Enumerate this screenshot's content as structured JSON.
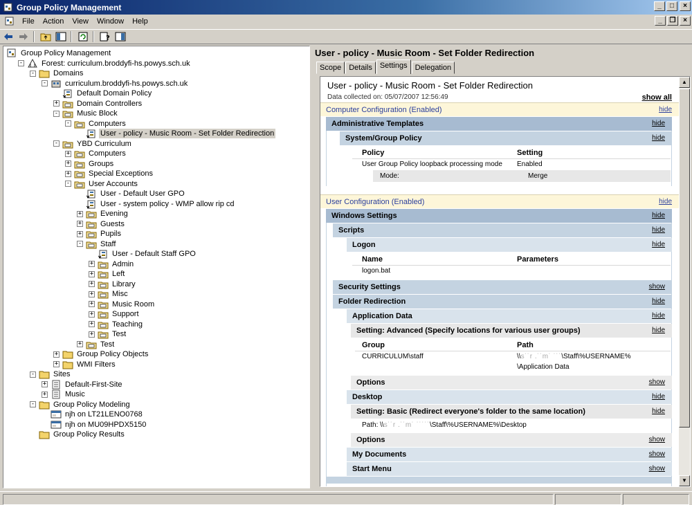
{
  "window": {
    "title": "Group Policy Management"
  },
  "menu": {
    "file": "File",
    "action": "Action",
    "view": "View",
    "window": "Window",
    "help": "Help"
  },
  "tree": [
    {
      "label": "Group Policy Management",
      "icon": "gpm-icon"
    },
    {
      "label": "Forest: curriculum.broddyfi-hs.powys.sch.uk",
      "icon": "forest-icon"
    },
    {
      "label": "Domains",
      "icon": "folder-icon"
    },
    {
      "label": "curriculum.broddyfi-hs.powys.sch.uk",
      "icon": "domain-icon"
    },
    {
      "label": "Default Domain Policy",
      "icon": "gpo-link-icon"
    },
    {
      "label": "Domain Controllers",
      "icon": "ou-icon"
    },
    {
      "label": "Music Block",
      "icon": "ou-icon"
    },
    {
      "label": "Computers",
      "icon": "ou-icon"
    },
    {
      "label": "User - policy - Music Room - Set Folder Redirection",
      "icon": "gpo-link-icon"
    },
    {
      "label": "YBD Curriculum",
      "icon": "ou-icon"
    },
    {
      "label": "Computers",
      "icon": "ou-icon"
    },
    {
      "label": "Groups",
      "icon": "ou-icon"
    },
    {
      "label": "Special Exceptions",
      "icon": "ou-icon"
    },
    {
      "label": "User Accounts",
      "icon": "ou-icon"
    },
    {
      "label": "User - Default User GPO",
      "icon": "gpo-link-icon"
    },
    {
      "label": "User - system policy - WMP allow rip cd",
      "icon": "gpo-link-icon"
    },
    {
      "label": "Evening",
      "icon": "ou-icon"
    },
    {
      "label": "Guests",
      "icon": "ou-icon"
    },
    {
      "label": "Pupils",
      "icon": "ou-icon"
    },
    {
      "label": "Staff",
      "icon": "ou-icon"
    },
    {
      "label": "User - Default Staff GPO",
      "icon": "gpo-link-icon"
    },
    {
      "label": "Admin",
      "icon": "ou-icon"
    },
    {
      "label": "Left",
      "icon": "ou-icon"
    },
    {
      "label": "Library",
      "icon": "ou-icon"
    },
    {
      "label": "Misc",
      "icon": "ou-icon"
    },
    {
      "label": "Music Room",
      "icon": "ou-icon"
    },
    {
      "label": "Support",
      "icon": "ou-icon"
    },
    {
      "label": "Teaching",
      "icon": "ou-icon"
    },
    {
      "label": "Test",
      "icon": "ou-icon"
    },
    {
      "label": "Test",
      "icon": "ou-icon"
    },
    {
      "label": "Group Policy Objects",
      "icon": "folder-icon"
    },
    {
      "label": "WMI Filters",
      "icon": "folder-icon"
    },
    {
      "label": "Sites",
      "icon": "folder-icon"
    },
    {
      "label": "Default-First-Site",
      "icon": "site-icon"
    },
    {
      "label": "Music",
      "icon": "site-icon"
    },
    {
      "label": "Group Policy Modeling",
      "icon": "folder-icon"
    },
    {
      "label": "njh on LT21LENO0768",
      "icon": "modeling-icon"
    },
    {
      "label": "njh on MU09HPDX5150",
      "icon": "modeling-icon"
    },
    {
      "label": "Group Policy Results",
      "icon": "folder-icon"
    }
  ],
  "right": {
    "title": "User - policy - Music Room - Set Folder Redirection",
    "tabs": [
      "Scope",
      "Details",
      "Settings",
      "Delegation"
    ],
    "report": {
      "title": "User - policy - Music Room - Set Folder Redirection",
      "date": "Data collected on: 05/07/2007 12:56:49",
      "show_all": "show all",
      "hide": "hide",
      "show": "show",
      "computer_config": "Computer Configuration (Enabled)",
      "admin_templates": "Administrative Templates",
      "system_gp": "System/Group Policy",
      "col_policy": "Policy",
      "col_setting": "Setting",
      "policy_name": "User Group Policy loopback processing mode",
      "policy_value": "Enabled",
      "mode_label": "Mode:",
      "mode_value": "Merge",
      "user_config": "User Configuration (Enabled)",
      "windows_settings": "Windows Settings",
      "scripts": "Scripts",
      "logon": "Logon",
      "col_name": "Name",
      "col_parameters": "Parameters",
      "logon_script": "logon.bat",
      "security_settings": "Security Settings",
      "folder_redirection": "Folder Redirection",
      "application_data": "Application Data",
      "setting_advanced": "Setting: Advanced (Specify locations for various user groups)",
      "col_group": "Group",
      "col_path": "Path",
      "group_value": "CURRICULUM\\staff",
      "path_line1_prefix": "\\\\",
      "path_line1_blurred": "s˙˙r .˙˙m˙ ˙˙˙",
      "path_line1_suffix": "\\Staff\\%USERNAME%",
      "path_line2": "\\Application Data",
      "options": "Options",
      "desktop": "Desktop",
      "setting_basic": "Setting: Basic (Redirect everyone's folder to the same location)",
      "path_desktop_prefix": "Path: \\\\",
      "path_desktop_blurred": "s˙˙r .˙˙m˙ ˙˙˙˙˙",
      "path_desktop_suffix": "\\Staff\\%USERNAME%\\Desktop",
      "my_documents": "My Documents",
      "start_menu": "Start Menu"
    }
  },
  "colors": {
    "title_start": "#0a246a",
    "title_end": "#a6caf0",
    "config_bar": "#fdf6d9",
    "config_text": "#2a3e9c"
  }
}
